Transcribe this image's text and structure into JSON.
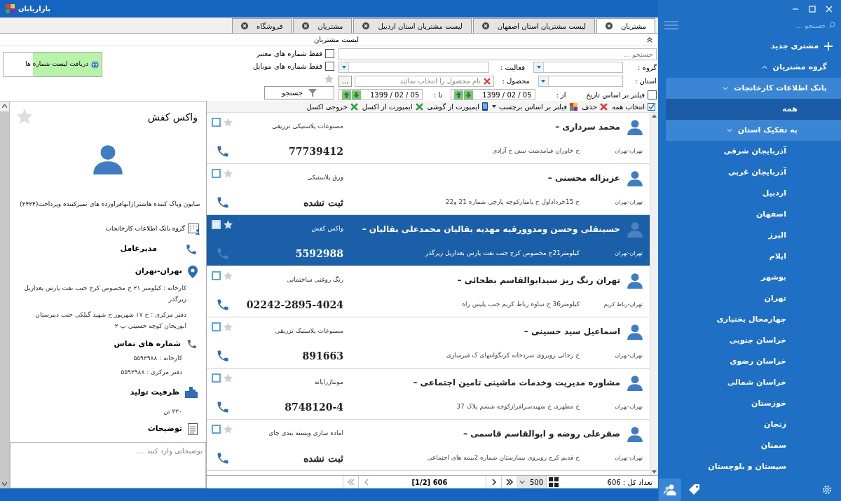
{
  "window": {
    "title": "بازاریابان"
  },
  "tabs": [
    {
      "label": "مشتریان",
      "selected": true
    },
    {
      "label": "لیست مشتریان استان اصفهان",
      "selected": false
    },
    {
      "label": "لیست مشتریان استان اردبیل",
      "selected": false
    },
    {
      "label": "مشتریان",
      "selected": false
    },
    {
      "label": "فروشگاه",
      "selected": false
    }
  ],
  "section_title": "لیست مشتریان",
  "filters": {
    "search_placeholder": "جستجو ...",
    "valid_only": {
      "label": "فقط شماره های معتبر",
      "checked": false
    },
    "mobile_only": {
      "label": "فقط شماره های موبایل",
      "checked": false
    },
    "group_label": "گروه :",
    "activity_label": "فعالیت :",
    "province_label": "استان :",
    "product_label": "محصول :",
    "product_placeholder": "نام محصول را انتخاب نمائید",
    "browse_button": "...",
    "date_filter": {
      "label": "فیلتر بر اساس تاریخ",
      "checked": false
    },
    "from_label": "از :",
    "from_date": "1399 / 02 / 05",
    "to_label": "تا :",
    "to_date": "1399 / 02 / 05",
    "search_button": "جستجو",
    "fetch_button": "دریافت لیست شماره ها"
  },
  "toolbar": {
    "select_all": {
      "label": "انتخاب همه",
      "checked": true
    },
    "actions": [
      {
        "kind": "delete",
        "label": "حذف"
      },
      {
        "kind": "tag_filter",
        "label": "فیلتر بر اساس برچسب"
      },
      {
        "kind": "phone_import",
        "label": "ایمپورت از گوشی"
      },
      {
        "kind": "excel_import",
        "label": "ایمپورت از اکسل"
      },
      {
        "kind": "excel_export",
        "label": "خروجی اکسل"
      }
    ]
  },
  "customers": [
    {
      "name": "محمد سرداری –",
      "product": "مصنوعات پلاستیکی تزریقی",
      "location": "تهران-تهران",
      "address": "خ خاوران قیامدشت نبش خ آزادی",
      "phone": "77739412",
      "selected": false,
      "checked": false
    },
    {
      "name": "عزیزاله محسنی –",
      "product": "ورق پلاستیکی",
      "location": "تهران-تهران",
      "address": "خ 15خرداداول خ پامنارکوچه پارچی شماره 21 و22",
      "phone": "ثبت نشده",
      "selected": false,
      "checked": false
    },
    {
      "name": "حسینقلی وحسن ومدوورقیه مهدیه بقالیان محمدعلی بقالیان –",
      "product": "واکس کفش",
      "location": "تهران-تهران",
      "address": "کیلومتر21ج مخصوص کرج جنب نفت پارس بعدازپل زیرگذر",
      "phone": "5592988",
      "selected": true,
      "checked": false
    },
    {
      "name": "تهران رنگ ریز سیدابوالقاسم بطحائی –",
      "product": "رنگ روغنی ساختمانی",
      "location": "تهران-رباط کریم",
      "address": "کیلومتر36 ج ساوه رباط کریم جنب پلیس راه",
      "phone": "02242-2895-4024",
      "selected": false,
      "checked": false
    },
    {
      "name": "اسماعیل سید حسینی –",
      "product": "مصنوعات پلاستیک تزریقی",
      "location": "تهران-تهران",
      "address": "خ رجائی روبروی سردخانه کرنگوانتهای ک قیرسازی",
      "phone": "891663",
      "selected": false,
      "checked": false
    },
    {
      "name": "مشاوره مدیریت وخدمات ماشینی تامین اجتماعی –",
      "product": "مونتاژرایانه",
      "location": "تهران-تهران",
      "address": "خ مطهری خ شهیدسرافرازکوچه ششم پلاک 37",
      "phone": "8748120-4",
      "selected": false,
      "checked": false
    },
    {
      "name": "صفرعلی روضه و ابوالقاسم قاسمی –",
      "product": "اماده سازی وبسته بندی چای",
      "location": "تهران-تهران",
      "address": "خ قدیم کرج روبروی بیمارستان شماره 2بیمه های اجتماعی",
      "phone": "ثبت نشده",
      "selected": false,
      "checked": false
    }
  ],
  "pager": {
    "page_info": "[1/2] 606",
    "page_size": "500",
    "total": "تعداد کل : 606"
  },
  "detail": {
    "title": "واکس کفش",
    "description": "صابون وپاک کننده هاشتر(ژانهافراورده های تمیزکننده وپرداخت(۲۴۲۴)",
    "group": "گروه بانک اطلاعات کارخانجات",
    "role": "مدیرعامل",
    "location": "تهران-تهران",
    "addresses": [
      "کارخانه : کیلومتر ۲۱ ج مخصوص کرج جنب نفت پارس بعدازپل زیرگذر",
      "دفتر مرکزی : خ ۱۷ شهریور خ شهید گیلکی جنب دبیرستان ابوریحان کوچه حسینی پ ۲"
    ],
    "contacts_title": "شماره های تماس",
    "contacts": [
      "کارخانه : ۵۵۹۲۹۸۸",
      "دفتر مرکزی : ۵۵۹۲۹۸۸"
    ],
    "capacity_title": "ظرفیت تولید",
    "capacity": "۳۳۰ تن",
    "notes_title": "توضیحات",
    "notes_placeholder": "توضیحاتی وارد کنید ...."
  },
  "sidebar": {
    "search_placeholder": "جستجو ...",
    "items": [
      {
        "kind": "action",
        "label": "مشتری جدید"
      },
      {
        "kind": "group",
        "label": "گروه مشتریان",
        "expanded": true,
        "children": [
          {
            "label": "بانک اطلاعات کارخانجات",
            "expanded": true,
            "children": [
              {
                "label": "همه",
                "selected": true
              },
              {
                "label": "به تفکیک استان",
                "expanded": true,
                "selected": false,
                "children": [
                  {
                    "label": "آذربایجان شرقی"
                  },
                  {
                    "label": "آذربایجان غربی"
                  },
                  {
                    "label": "اردبیل"
                  },
                  {
                    "label": "اصفهان"
                  },
                  {
                    "label": "البرز"
                  },
                  {
                    "label": "ایلام"
                  },
                  {
                    "label": "بوشهر"
                  },
                  {
                    "label": "تهران"
                  },
                  {
                    "label": "چهارمحال بختیاری"
                  },
                  {
                    "label": "خراسان جنوبی"
                  },
                  {
                    "label": "خراسان رضوی"
                  },
                  {
                    "label": "خراسان شمالی"
                  },
                  {
                    "label": "خوزستان"
                  },
                  {
                    "label": "زنجان"
                  },
                  {
                    "label": "سمنان"
                  },
                  {
                    "label": "سیستان و بلوچستان"
                  }
                ]
              }
            ]
          }
        ]
      }
    ]
  }
}
